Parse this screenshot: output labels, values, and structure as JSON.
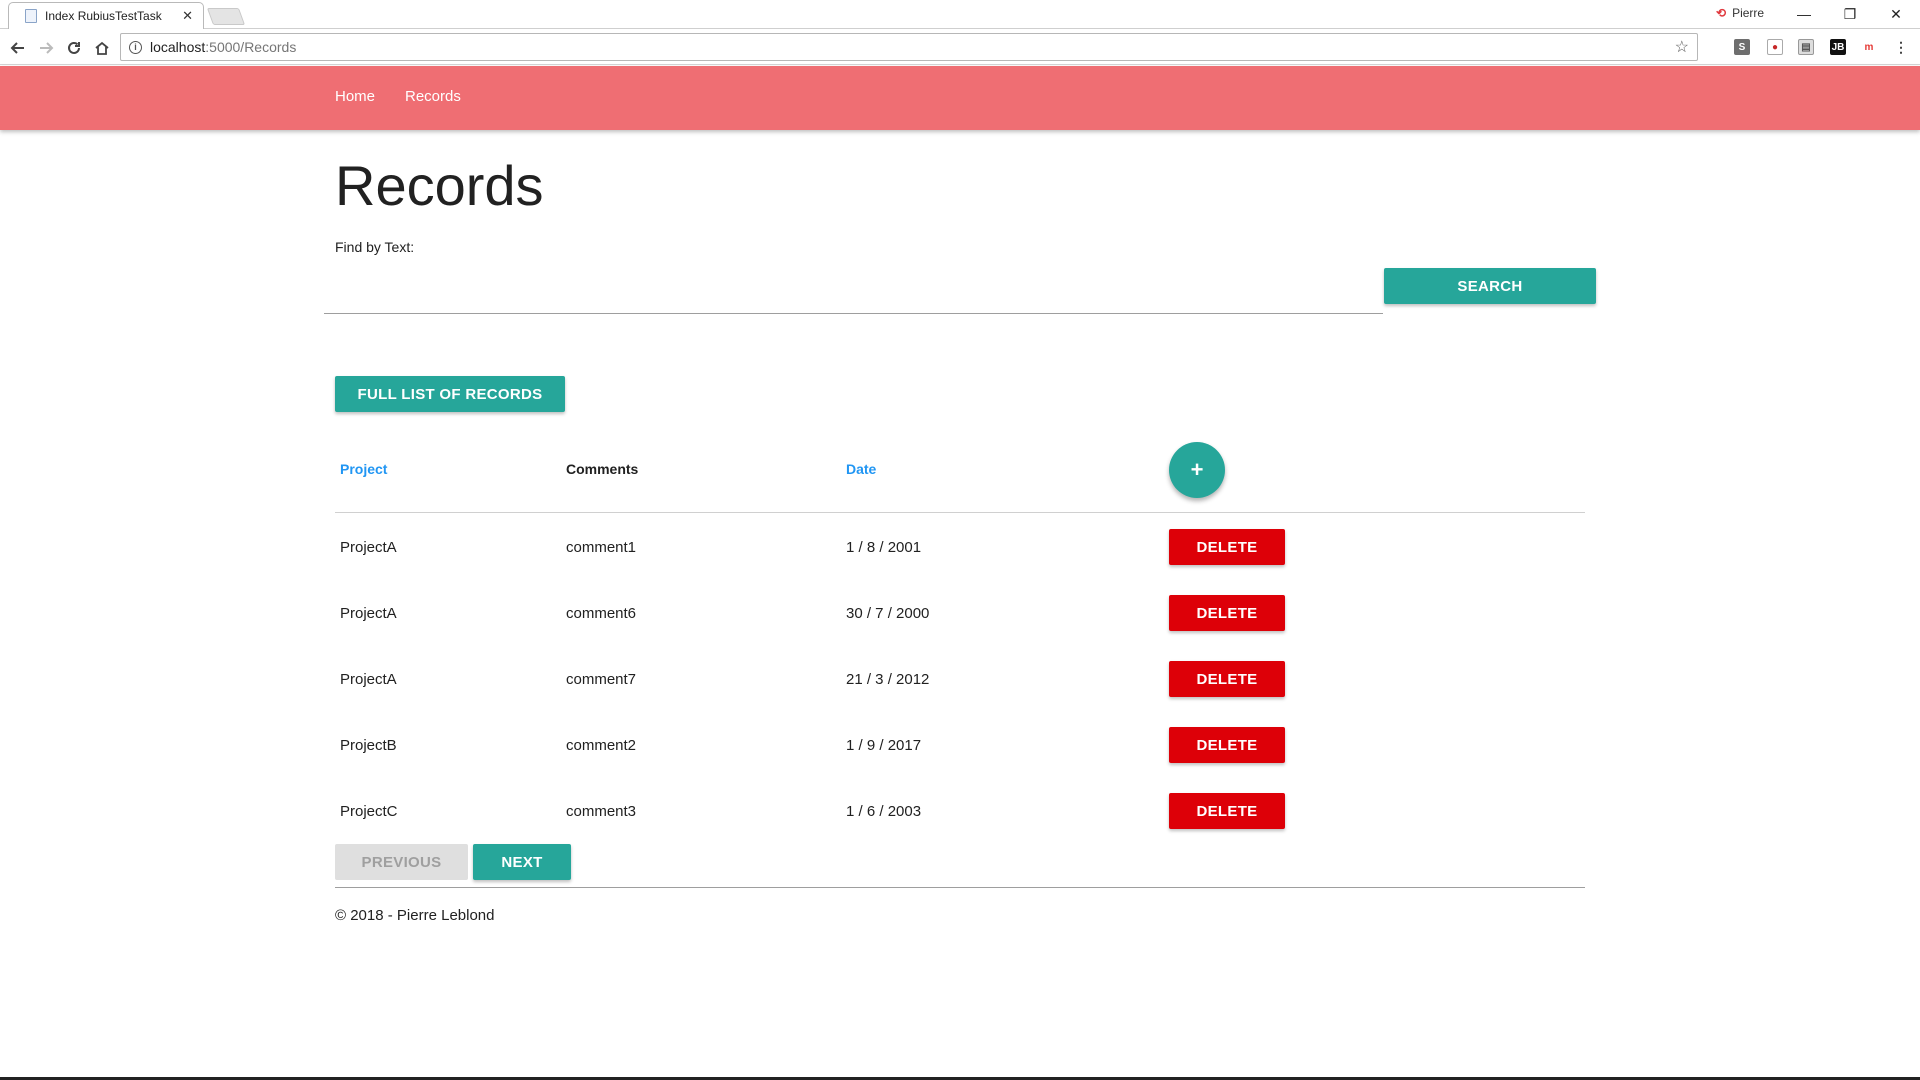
{
  "browser": {
    "tab_title": "Index RubiusTestTask",
    "tab_close": "✕",
    "profile_name": "Pierre",
    "url_host": "localhost",
    "url_path": ":5000/Records",
    "window_controls": {
      "minimize": "—",
      "restore": "❐",
      "close": "✕"
    }
  },
  "navbar": {
    "links": [
      "Home",
      "Records"
    ],
    "background": "#ef6e73"
  },
  "page": {
    "title": "Records",
    "find_label": "Find by Text:",
    "search_value": "",
    "search_button": "SEARCH",
    "full_list_button": "FULL LIST OF RECORDS"
  },
  "table": {
    "headers": {
      "project": "Project",
      "comments": "Comments",
      "date": "Date"
    },
    "add_button": "+",
    "delete_label": "DELETE",
    "rows": [
      {
        "project": "ProjectA",
        "comment": "comment1",
        "date": "1 / 8 / 2001"
      },
      {
        "project": "ProjectA",
        "comment": "comment6",
        "date": "30 / 7 / 2000"
      },
      {
        "project": "ProjectA",
        "comment": "comment7",
        "date": "21 / 3 / 2012"
      },
      {
        "project": "ProjectB",
        "comment": "comment2",
        "date": "1 / 9 / 2017"
      },
      {
        "project": "ProjectC",
        "comment": "comment3",
        "date": "1 / 6 / 2003"
      }
    ]
  },
  "pagination": {
    "previous": "PREVIOUS",
    "next": "NEXT",
    "previous_enabled": false
  },
  "footer": {
    "text": "© 2018 - Pierre Leblond"
  },
  "colors": {
    "accent": "#26a69a",
    "danger": "#dd0008",
    "link": "#2196f3"
  }
}
